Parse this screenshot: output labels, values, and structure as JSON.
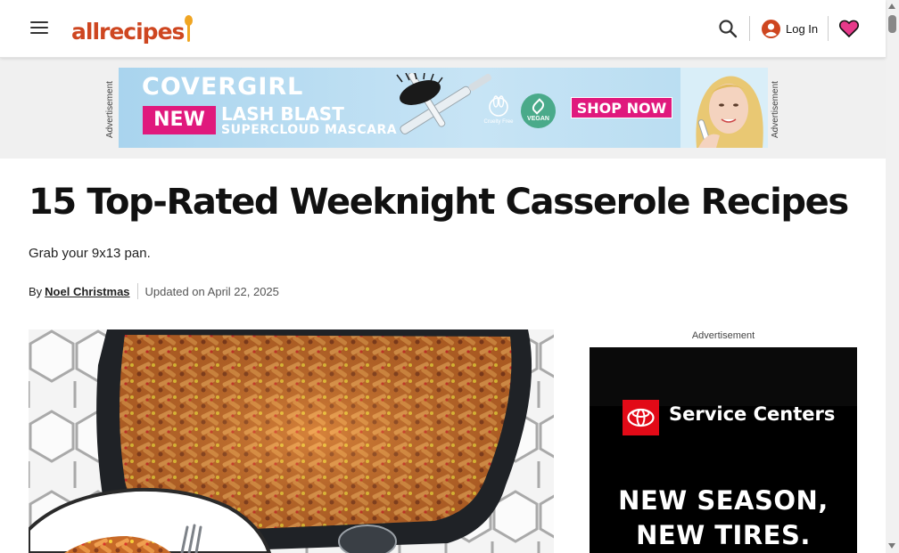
{
  "header": {
    "logo_text": "allrecipes",
    "login_label": "Log In",
    "brand_color": "#ce4620",
    "icons": [
      "menu-icon",
      "search-icon",
      "user-icon",
      "heart-icon"
    ]
  },
  "top_ad": {
    "side_label": "Advertisement",
    "brand": "COVERGIRL",
    "badge": "NEW",
    "product_line1": "LASH BLAST",
    "product_line2": "SUPERCLOUD MASCARA",
    "cruelty_free_text": "Cruelty Free",
    "vegan_text": "VEGAN",
    "cta": "SHOP NOW",
    "accent_color": "#e0197d"
  },
  "article": {
    "title": "15 Top-Rated Weeknight Casserole Recipes",
    "subtitle": "Grab your 9x13 pan.",
    "by_label": "By",
    "author": "Noel Christmas",
    "updated": "Updated on April 22, 2025"
  },
  "rail_ad": {
    "label": "Advertisement",
    "brand_text": "Service Centers",
    "headline_line1": "NEW SEASON,",
    "headline_line2": "NEW TIRES."
  }
}
